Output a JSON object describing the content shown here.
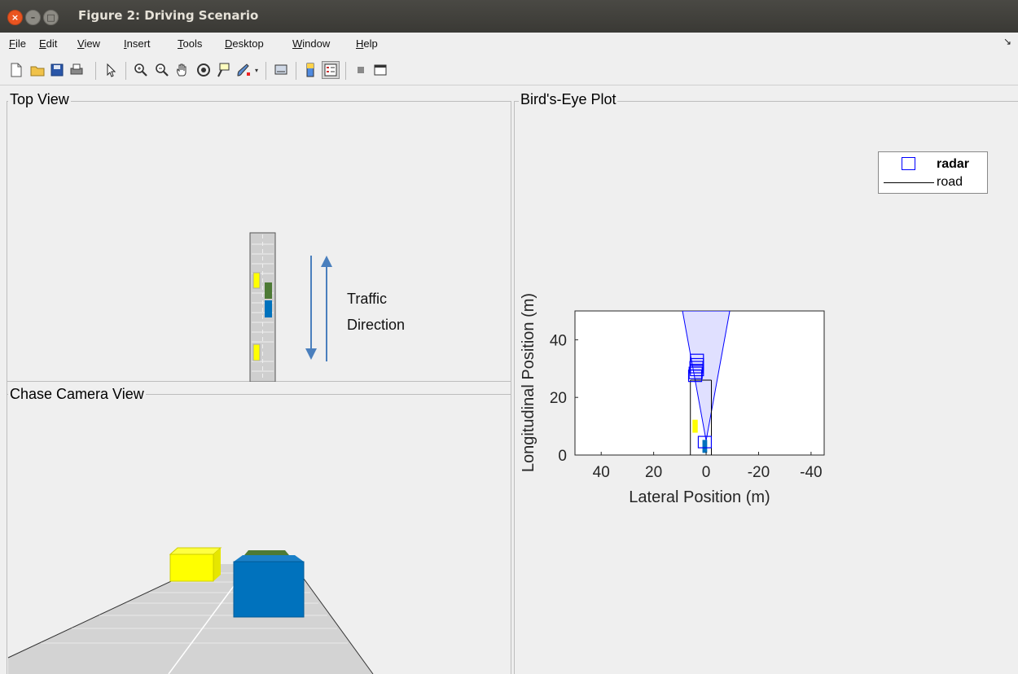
{
  "window": {
    "title": "Figure 2: Driving Scenario"
  },
  "menu": [
    "File",
    "Edit",
    "View",
    "Insert",
    "Tools",
    "Desktop",
    "Window",
    "Help"
  ],
  "panels": {
    "top_view": {
      "title": "Top View",
      "annotation_line1": "Traffic",
      "annotation_line2": "Direction"
    },
    "chase_view": {
      "title": "Chase Camera View"
    },
    "birds_eye": {
      "title": "Bird's-Eye Plot"
    }
  },
  "colors": {
    "ego": "#0072bd",
    "yellow_car": "#ffff00",
    "green_car": "#4d7a35",
    "radar": "#0000ff",
    "arrow": "#4a7fbd"
  },
  "chart_data": {
    "type": "scatter",
    "xlabel": "Lateral Position (m)",
    "ylabel": "Longitudinal Position (m)",
    "xlim": [
      50,
      -45
    ],
    "ylim": [
      0,
      50
    ],
    "xticks": [
      {
        "v": 40,
        "label": "40"
      },
      {
        "v": 20,
        "label": "20"
      },
      {
        "v": 0,
        "label": "0"
      },
      {
        "v": -20,
        "label": "-20"
      },
      {
        "v": -40,
        "label": "-40"
      }
    ],
    "yticks": [
      {
        "v": 0,
        "label": "0"
      },
      {
        "v": 20,
        "label": "20"
      },
      {
        "v": 40,
        "label": "40"
      }
    ],
    "legend": {
      "placement": "top-right",
      "entries": [
        "radar",
        "road"
      ]
    },
    "road_boundaries": {
      "x": [
        6,
        -2
      ],
      "y_max": 26
    },
    "radar_coverage": {
      "apex": [
        0,
        5
      ],
      "top_left": [
        9,
        50
      ],
      "top_right": [
        -9,
        50
      ]
    },
    "radar_detections": [
      {
        "x": 3.5,
        "y": 33
      },
      {
        "x": 3.5,
        "y": 31.5
      },
      {
        "x": 3.7,
        "y": 30.5
      },
      {
        "x": 3.5,
        "y": 29.5
      },
      {
        "x": 4.0,
        "y": 28.5
      },
      {
        "x": 4.2,
        "y": 27.5
      },
      {
        "x": 0.5,
        "y": 4.5
      }
    ],
    "objects": [
      {
        "label": "yellow",
        "x": 4.2,
        "y": 10,
        "length": 4.5,
        "width": 2
      },
      {
        "label": "ego",
        "x": 0.5,
        "y": 3,
        "length": 4.5,
        "width": 1.8
      }
    ]
  }
}
